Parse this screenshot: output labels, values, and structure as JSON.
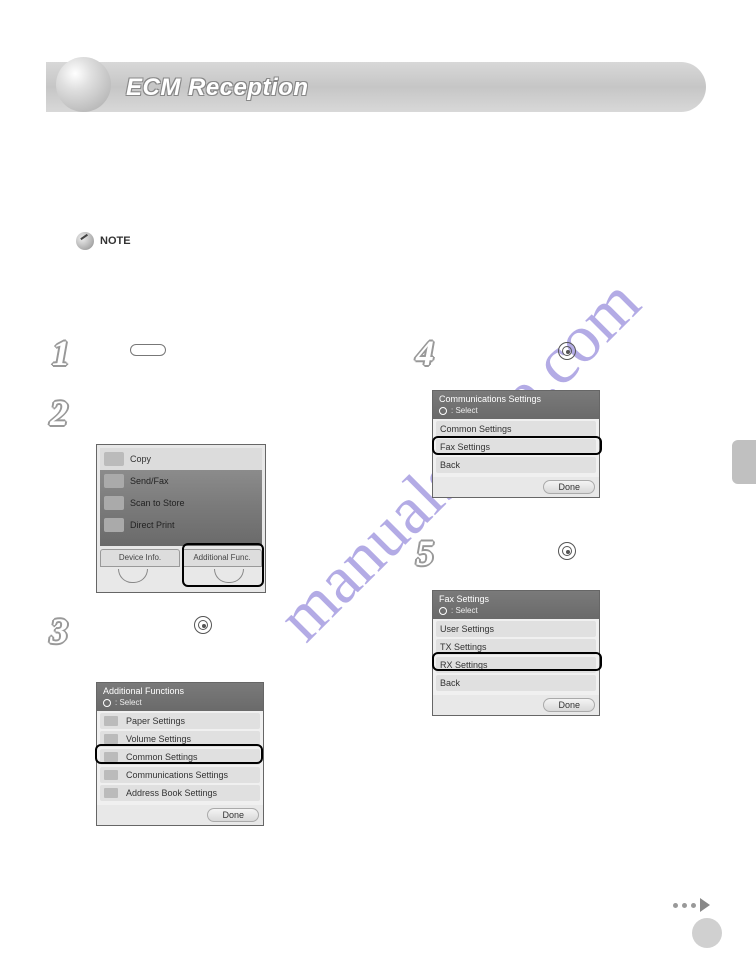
{
  "title": "ECM Reception",
  "note": {
    "label": "NOTE"
  },
  "watermark": "manualshive.com",
  "steps": [
    "1",
    "2",
    "3",
    "4",
    "5"
  ],
  "main_menu": {
    "items": [
      "Copy",
      "Send/Fax",
      "Scan to Store",
      "Direct Print"
    ],
    "tabs": [
      "Device Info.",
      "Additional Func."
    ]
  },
  "screen3": {
    "header_title": "Additional Functions",
    "header_sub": ": Select",
    "items": [
      "Paper Settings",
      "Volume Settings",
      "Common Settings",
      "Communications Settings",
      "Address Book Settings"
    ],
    "done": "Done"
  },
  "screen4": {
    "header_title": "Communications Settings",
    "header_sub": ": Select",
    "items": [
      "Common Settings",
      "Fax Settings",
      "Back"
    ],
    "done": "Done"
  },
  "screen5": {
    "header_title": "Fax Settings",
    "header_sub": ": Select",
    "items": [
      "User Settings",
      "TX Settings",
      "RX Settings",
      "Back"
    ],
    "done": "Done"
  }
}
